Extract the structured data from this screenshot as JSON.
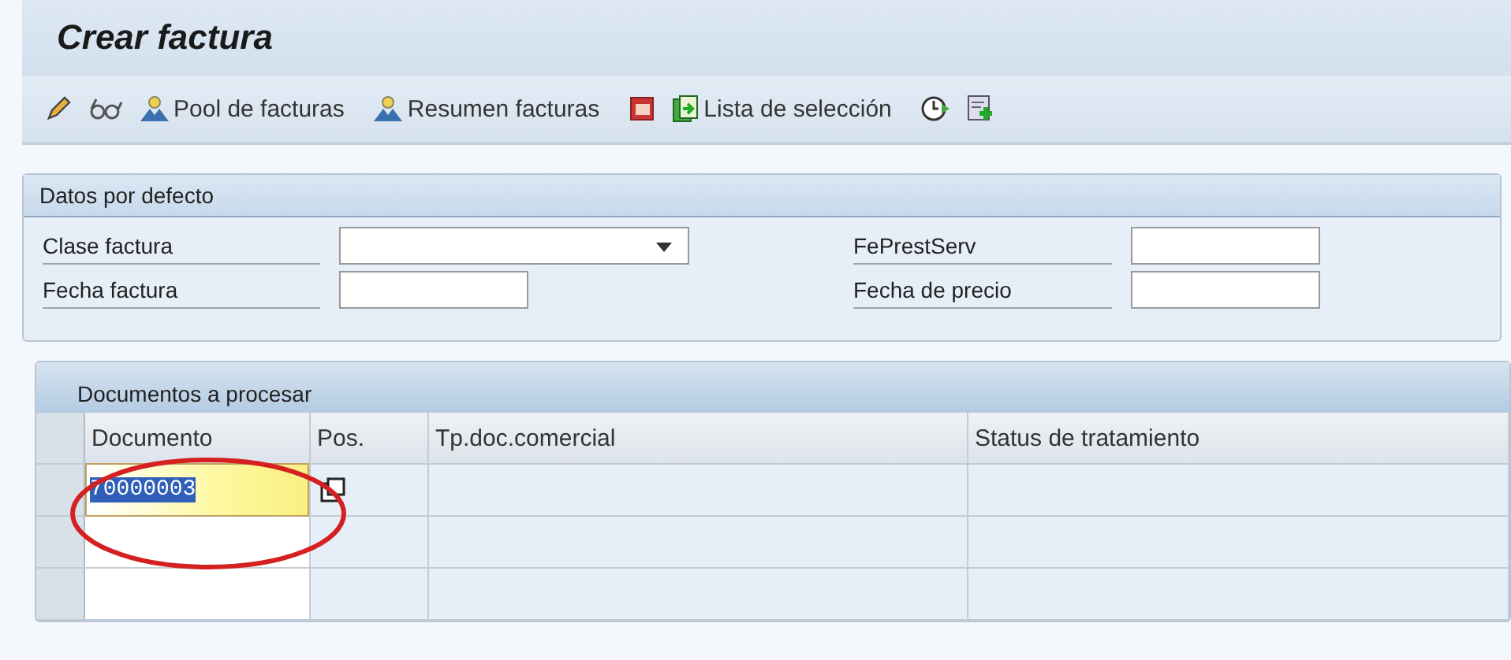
{
  "window": {
    "title": "Crear factura"
  },
  "toolbar": {
    "buttons": [
      {
        "label": "Pool de facturas"
      },
      {
        "label": "Resumen facturas"
      },
      {
        "label": "Lista de selección"
      }
    ]
  },
  "defaults": {
    "title": "Datos por defecto",
    "fields": [
      {
        "label": "Clase factura",
        "kind": "dropdown"
      },
      {
        "label": "FePrestServ",
        "kind": "input"
      },
      {
        "label": "Fecha factura",
        "kind": "input"
      },
      {
        "label": "Fecha de precio",
        "kind": "input"
      }
    ]
  },
  "table": {
    "title": "Documentos a procesar",
    "columns": [
      "Documento",
      "Pos.",
      "Tp.doc.comercial",
      "Status de tratamiento"
    ],
    "rows": [
      {
        "document": "70000003",
        "selected": true
      },
      {
        "selected": false
      },
      {
        "selected": false
      }
    ]
  }
}
